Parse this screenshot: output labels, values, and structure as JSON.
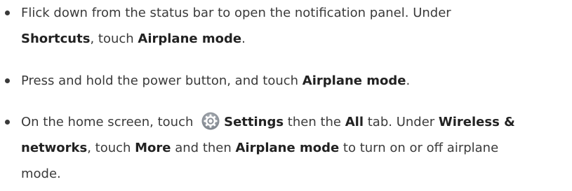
{
  "item1": {
    "t1": "Flick down from the status bar to open the notification panel. Under",
    "b1": "Shortcuts",
    "t2": ", touch ",
    "b2": "Airplane mode",
    "t3": "."
  },
  "item2": {
    "t1": "Press and hold the power button, and touch ",
    "b1": "Airplane mode",
    "t2": "."
  },
  "item3": {
    "t1": "On the home screen, touch ",
    "icon": "settings-gear-icon",
    "b1": "Settings",
    "t2": " then the ",
    "b2": "All",
    "t3": " tab. Under ",
    "b3": "Wireless &",
    "b4": "networks",
    "t4": ", touch ",
    "b5": "More",
    "t5": " and then ",
    "b6": "Airplane mode",
    "t6": " to turn on or off airplane",
    "t7": "mode."
  },
  "colors": {
    "text": "#3a3a3a",
    "bold": "#222222",
    "icon_gray": "#8a8f96"
  }
}
